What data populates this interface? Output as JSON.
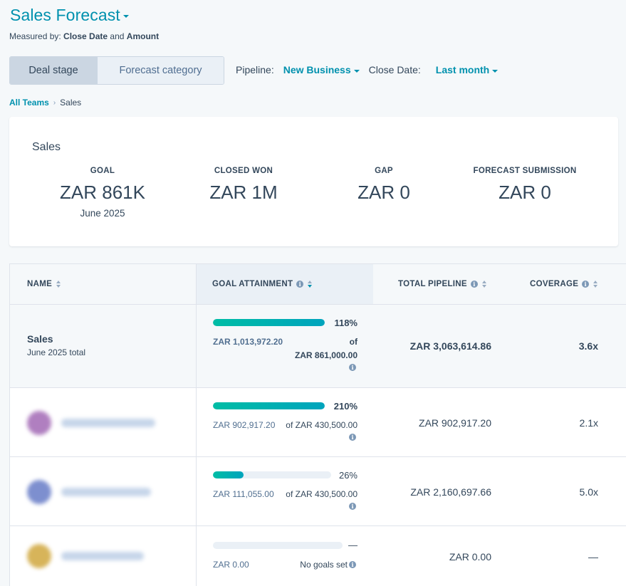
{
  "header": {
    "title": "Sales Forecast",
    "measured_prefix": "Measured by:",
    "measured_field1": "Close Date",
    "measured_and": "and",
    "measured_field2": "Amount"
  },
  "toggle": {
    "active": "Deal stage",
    "inactive": "Forecast category"
  },
  "filters": {
    "pipeline_label": "Pipeline:",
    "pipeline_value": "New Business",
    "close_date_label": "Close Date:",
    "close_date_value": "Last month"
  },
  "breadcrumb": {
    "root": "All Teams",
    "current": "Sales"
  },
  "summary_card": {
    "title": "Sales",
    "stats": [
      {
        "label": "GOAL",
        "value": "ZAR 861K",
        "sub": "June 2025"
      },
      {
        "label": "CLOSED WON",
        "value": "ZAR 1M",
        "sub": ""
      },
      {
        "label": "GAP",
        "value": "ZAR 0",
        "sub": ""
      },
      {
        "label": "FORECAST SUBMISSION",
        "value": "ZAR 0",
        "sub": ""
      }
    ]
  },
  "table": {
    "columns": {
      "name": "NAME",
      "goal_attainment": "GOAL ATTAINMENT",
      "total_pipeline": "TOTAL PIPELINE",
      "coverage": "COVERAGE"
    },
    "summary_row": {
      "name": "Sales",
      "sub": "June 2025 total",
      "progress": 1.0,
      "percent": "118%",
      "amount": "ZAR 1,013,972.20",
      "of_label": "of",
      "goal": "ZAR 861,000.00",
      "pipeline": "ZAR 3,063,614.86",
      "coverage": "3.6x"
    },
    "rows": [
      {
        "progress": 1.0,
        "percent": "210%",
        "amount": "ZAR 902,917.20",
        "goal": "of ZAR 430,500.00",
        "pipeline": "ZAR 902,917.20",
        "coverage": "2.1x",
        "avatar_color": "#b07fc0"
      },
      {
        "progress": 0.26,
        "percent": "26%",
        "amount": "ZAR 111,055.00",
        "goal": "of ZAR 430,500.00",
        "pipeline": "ZAR 2,160,697.66",
        "coverage": "5.0x",
        "avatar_color": "#7d8fcf"
      },
      {
        "progress": 0,
        "percent": "—",
        "amount": "ZAR 0.00",
        "goal": "No goals set",
        "pipeline": "ZAR 0.00",
        "coverage": "—",
        "avatar_color": "#d7b45a"
      }
    ]
  },
  "colors": {
    "accent": "#0091ae",
    "bar_start": "#00bda5",
    "bar_end": "#00a4bd",
    "text": "#33475b"
  }
}
